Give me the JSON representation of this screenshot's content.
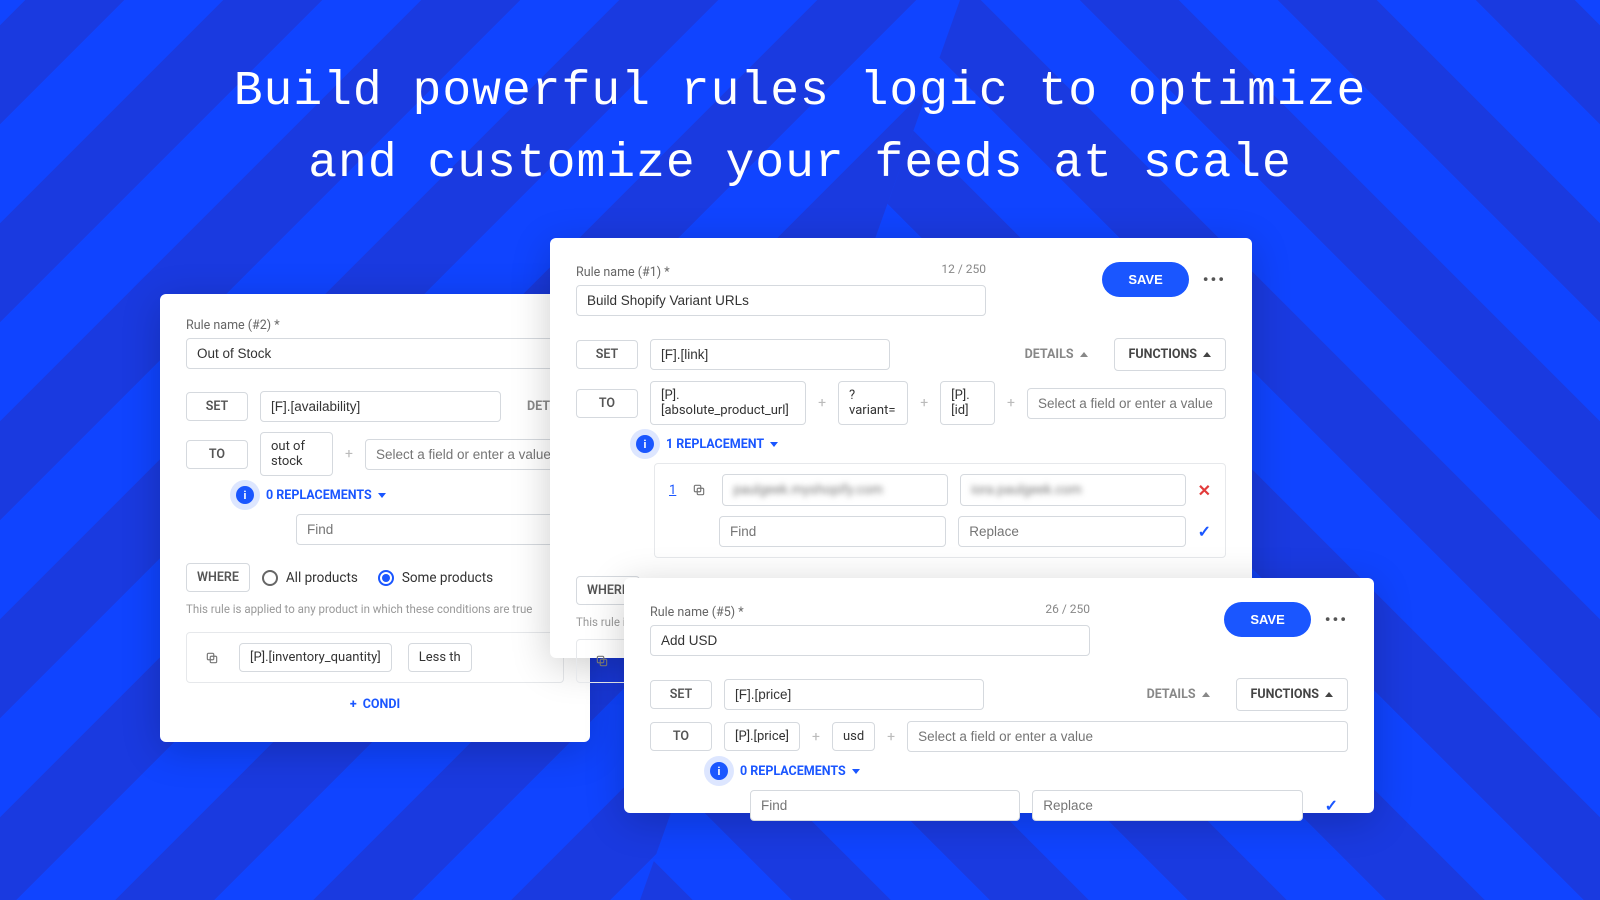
{
  "headline": "Build powerful rules logic to optimize\nand customize your feeds at scale",
  "common": {
    "save": "SAVE",
    "details": "DETAILS",
    "functions": "FUNCTIONS",
    "set": "SET",
    "to": "TO",
    "where": "WHERE",
    "all_products": "All products",
    "some_products": "Some products",
    "find_ph": "Find",
    "replace_ph": "Replace",
    "select_field_ph": "Select a field or enter a value",
    "condition_label": "CONDI",
    "hint_text": "This rule is applied to any product in which these conditions are true"
  },
  "card2": {
    "label": "Rule name (#2) *",
    "name": "Out of Stock",
    "set_field": "[F].[availability]",
    "to_token": "out of stock",
    "replacements": "0 REPLACEMENTS",
    "cond_token": "[P].[inventory_quantity]",
    "cond_op": "Less th",
    "details_cut": "DET"
  },
  "card1": {
    "label": "Rule name (#1) *",
    "name": "Build Shopify Variant URLs",
    "count": "12 / 250",
    "set_field": "[F].[link]",
    "to_tokens": [
      "[P].[absolute_product_url]",
      "?variant=",
      "[P].[id]"
    ],
    "replacements": "1 REPLACEMENT",
    "row_num": "1",
    "blur1": "paulgeek.myshopify.com",
    "blur2": "iora.paulgeek.com",
    "hint_cut": "This rule is appli"
  },
  "card5": {
    "label": "Rule name (#5) *",
    "name": "Add USD",
    "count": "26 / 250",
    "set_field": "[F].[price]",
    "to_tokens": [
      "[P].[price]",
      "usd"
    ],
    "replacements": "0 REPLACEMENTS"
  }
}
